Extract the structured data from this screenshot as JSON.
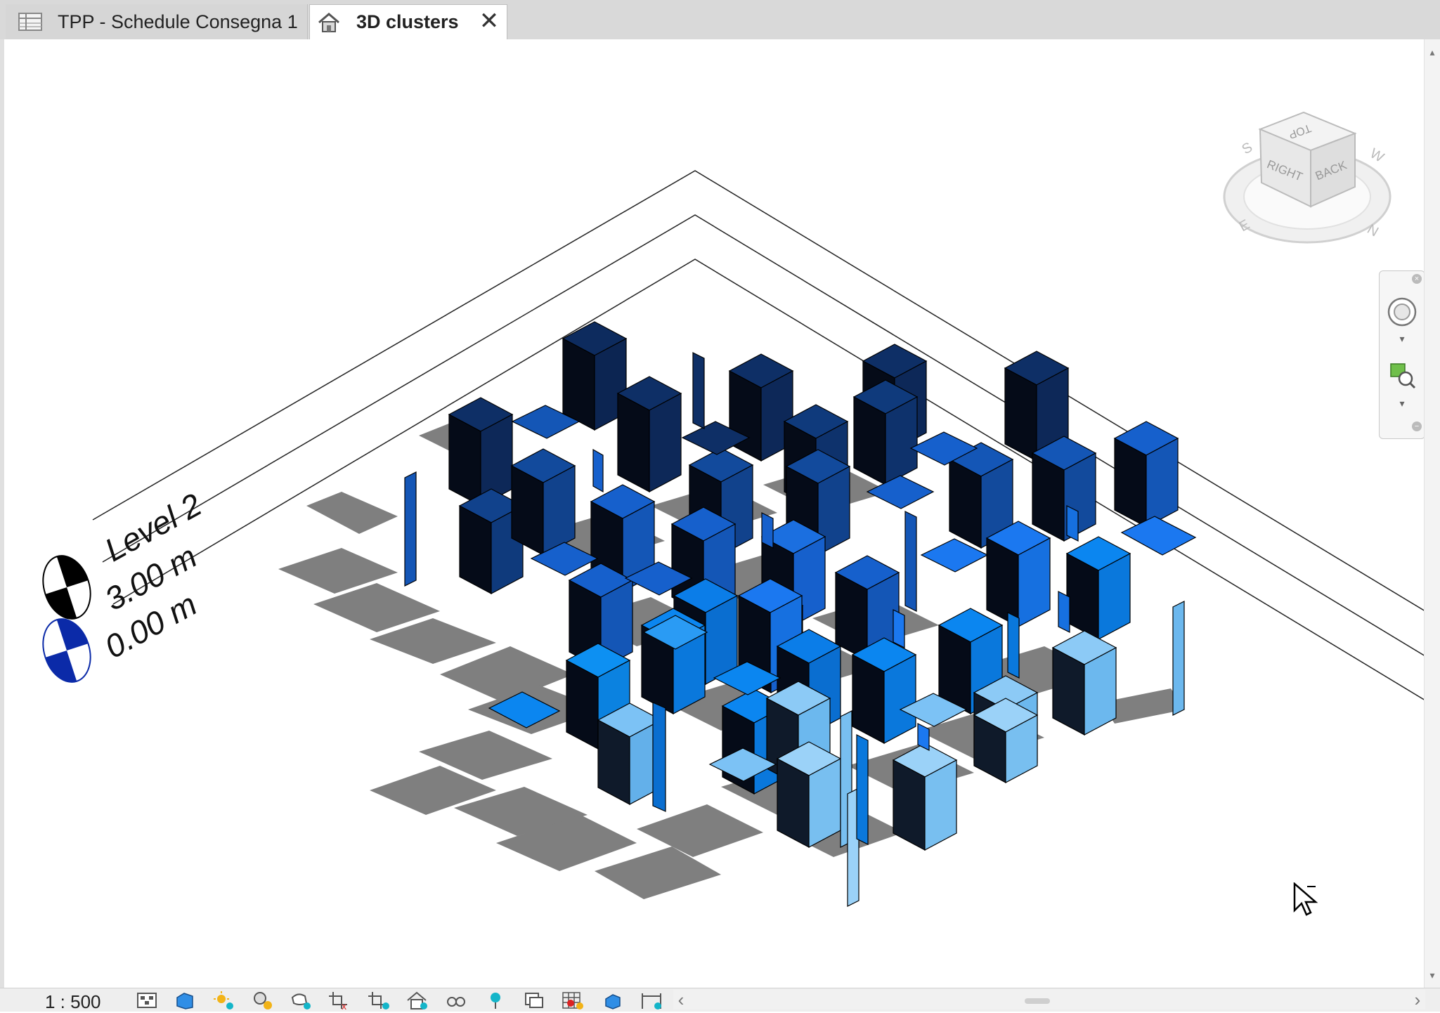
{
  "tabs": [
    {
      "label": "TPP - Schedule Consegna 1",
      "icon": "schedule-table-icon",
      "active": false
    },
    {
      "label": "3D clusters",
      "icon": "home-3d-icon",
      "active": true
    }
  ],
  "levels": {
    "level_name": "Level 2",
    "level_2_elevation": "3.00 m",
    "level_1_elevation": "0.00 m"
  },
  "viewcube": {
    "top_face": "TOP",
    "right_face": "RIGHT",
    "back_face": "BACK",
    "compass": [
      "S",
      "E",
      "N",
      "W"
    ]
  },
  "colors": {
    "dark_navy": "#0a1c3a",
    "mid_blue": "#0f55c4",
    "bright_blue": "#0b7de8",
    "light_blue": "#6ab8f2",
    "shadow": "#808080"
  },
  "statusbar": {
    "scale": "1 : 500",
    "icons": [
      "detail-level-icon",
      "visual-style-icon",
      "sun-path-icon",
      "shadows-icon",
      "rendering-icon",
      "crop-view-icon",
      "crop-region-icon",
      "unlock-3d-icon",
      "temporary-hide-icon",
      "reveal-hidden-icon",
      "worksharing-icon",
      "analytical-model-icon",
      "highlight-displacement-icon",
      "reveal-constraints-icon"
    ]
  }
}
